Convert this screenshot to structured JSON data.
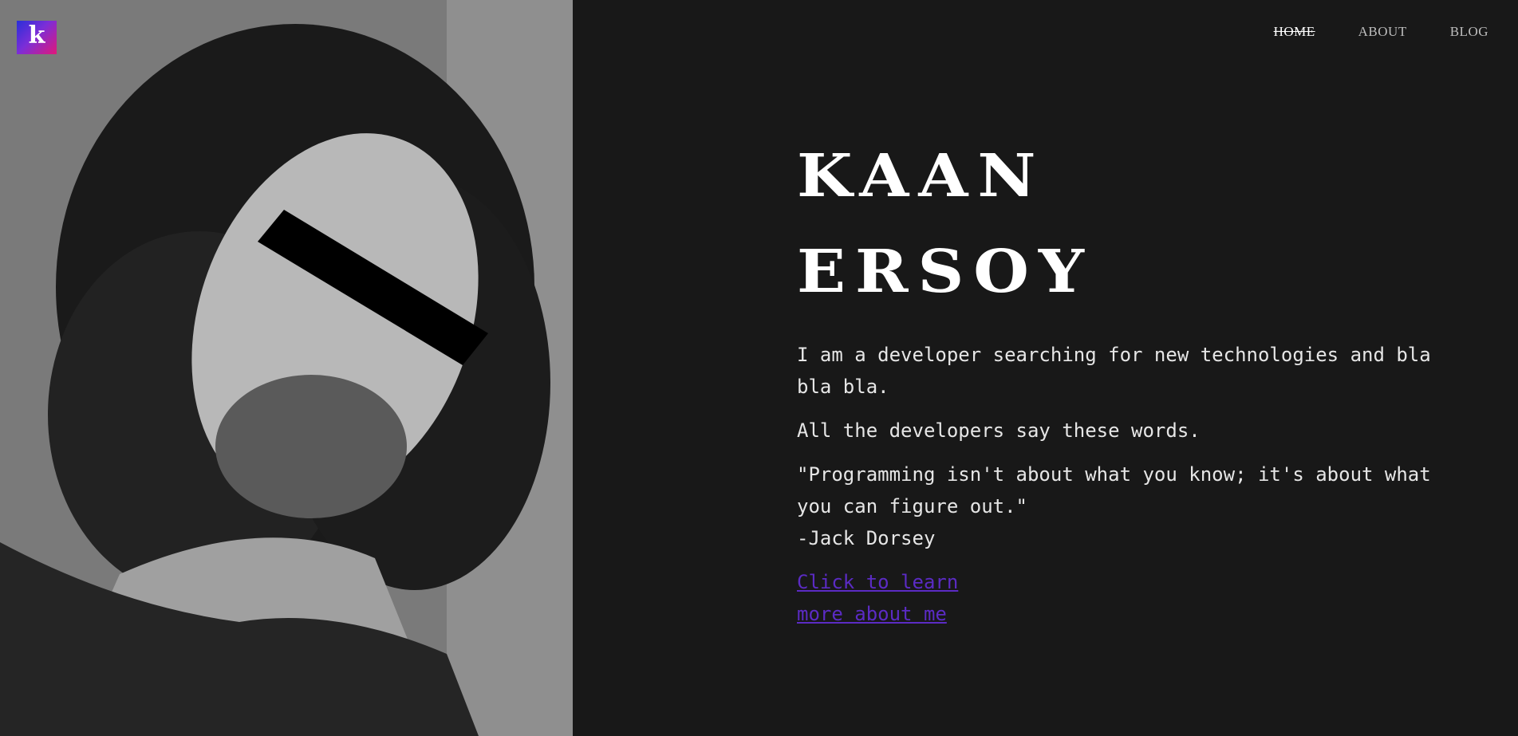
{
  "logo": {
    "letter": "k"
  },
  "nav": {
    "items": [
      {
        "label": "HOME",
        "active": true
      },
      {
        "label": "ABOUT",
        "active": false
      },
      {
        "label": "BLOG",
        "active": false
      }
    ]
  },
  "hero": {
    "first_name": "KAAN",
    "last_name": "ERSOY",
    "bio_line_1": "I am a developer searching for new technologies and bla bla bla.",
    "bio_line_2": "All the developers say these words.",
    "quote": "\"Programming isn't about what you know; it's about what you can figure out.\"",
    "quote_author": "-Jack Dorsey",
    "cta_label": "Click to learn more about me"
  },
  "colors": {
    "background": "#181818",
    "text": "#e6e6e6",
    "link": "#5b2bc4",
    "logo_gradient_start": "#2a2fd8",
    "logo_gradient_end": "#e0187a"
  }
}
